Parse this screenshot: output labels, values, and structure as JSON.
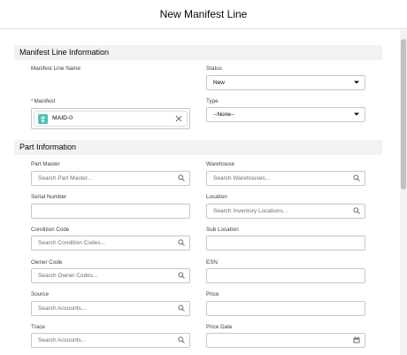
{
  "modal": {
    "title": "New Manifest Line"
  },
  "sections": {
    "manifest_info": "Manifest Line Information",
    "part_info": "Part Information"
  },
  "fields": {
    "manifest_line_name": {
      "label": "Manifest Line Name",
      "value": ""
    },
    "status": {
      "label": "Status",
      "value": "New",
      "icon": "chevron-down-icon"
    },
    "manifest": {
      "label": "Manifest",
      "required": "*",
      "value": "MAID-0",
      "icon": "manifest-object-icon",
      "remove_icon": "close-icon"
    },
    "type": {
      "label": "Type",
      "value": "--None--",
      "icon": "chevron-down-icon"
    },
    "part_master": {
      "label": "Part Master",
      "placeholder": "Search Part Master...",
      "icon": "search-icon"
    },
    "warehouse": {
      "label": "Warehouse",
      "placeholder": "Search Warehouses...",
      "icon": "search-icon"
    },
    "serial_number": {
      "label": "Serial Number",
      "value": ""
    },
    "location": {
      "label": "Location",
      "placeholder": "Search Inventory Locations...",
      "icon": "search-icon"
    },
    "condition_code": {
      "label": "Condition Code",
      "placeholder": "Search Condition Codes...",
      "icon": "search-icon"
    },
    "sub_location": {
      "label": "Sub Location",
      "value": ""
    },
    "owner_code": {
      "label": "Owner Code",
      "placeholder": "Search Owner Codes...",
      "icon": "search-icon"
    },
    "esn": {
      "label": "ESN",
      "value": ""
    },
    "source": {
      "label": "Source",
      "placeholder": "Search Accounts...",
      "icon": "search-icon"
    },
    "price": {
      "label": "Price",
      "value": ""
    },
    "trace": {
      "label": "Trace",
      "placeholder": "Search Accounts...",
      "icon": "search-icon"
    },
    "price_date": {
      "label": "Price Date",
      "value": "",
      "icon": "calendar-icon"
    }
  },
  "colors": {
    "section_bg": "#f3f2f2",
    "border": "#c9c7c5",
    "required": "#c23934",
    "manifest_icon": "#4bc0b2",
    "calendar_icon": "#706e6b"
  }
}
